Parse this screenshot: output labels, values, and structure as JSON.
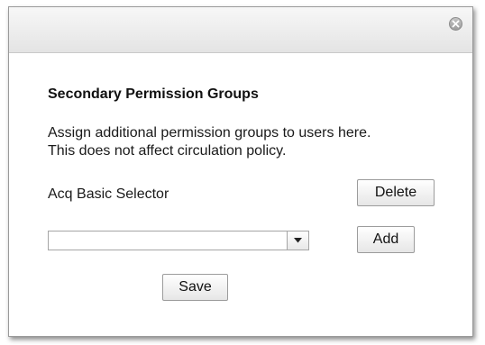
{
  "dialog": {
    "close_icon": "close-icon",
    "heading": "Secondary Permission Groups",
    "description_line1": "Assign additional permission groups to users here.",
    "description_line2": "This does not affect circulation policy.",
    "group_label": "Acq Basic Selector",
    "delete_label": "Delete",
    "select_value": "",
    "select_icon": "chevron-down-icon",
    "add_label": "Add",
    "save_label": "Save"
  }
}
